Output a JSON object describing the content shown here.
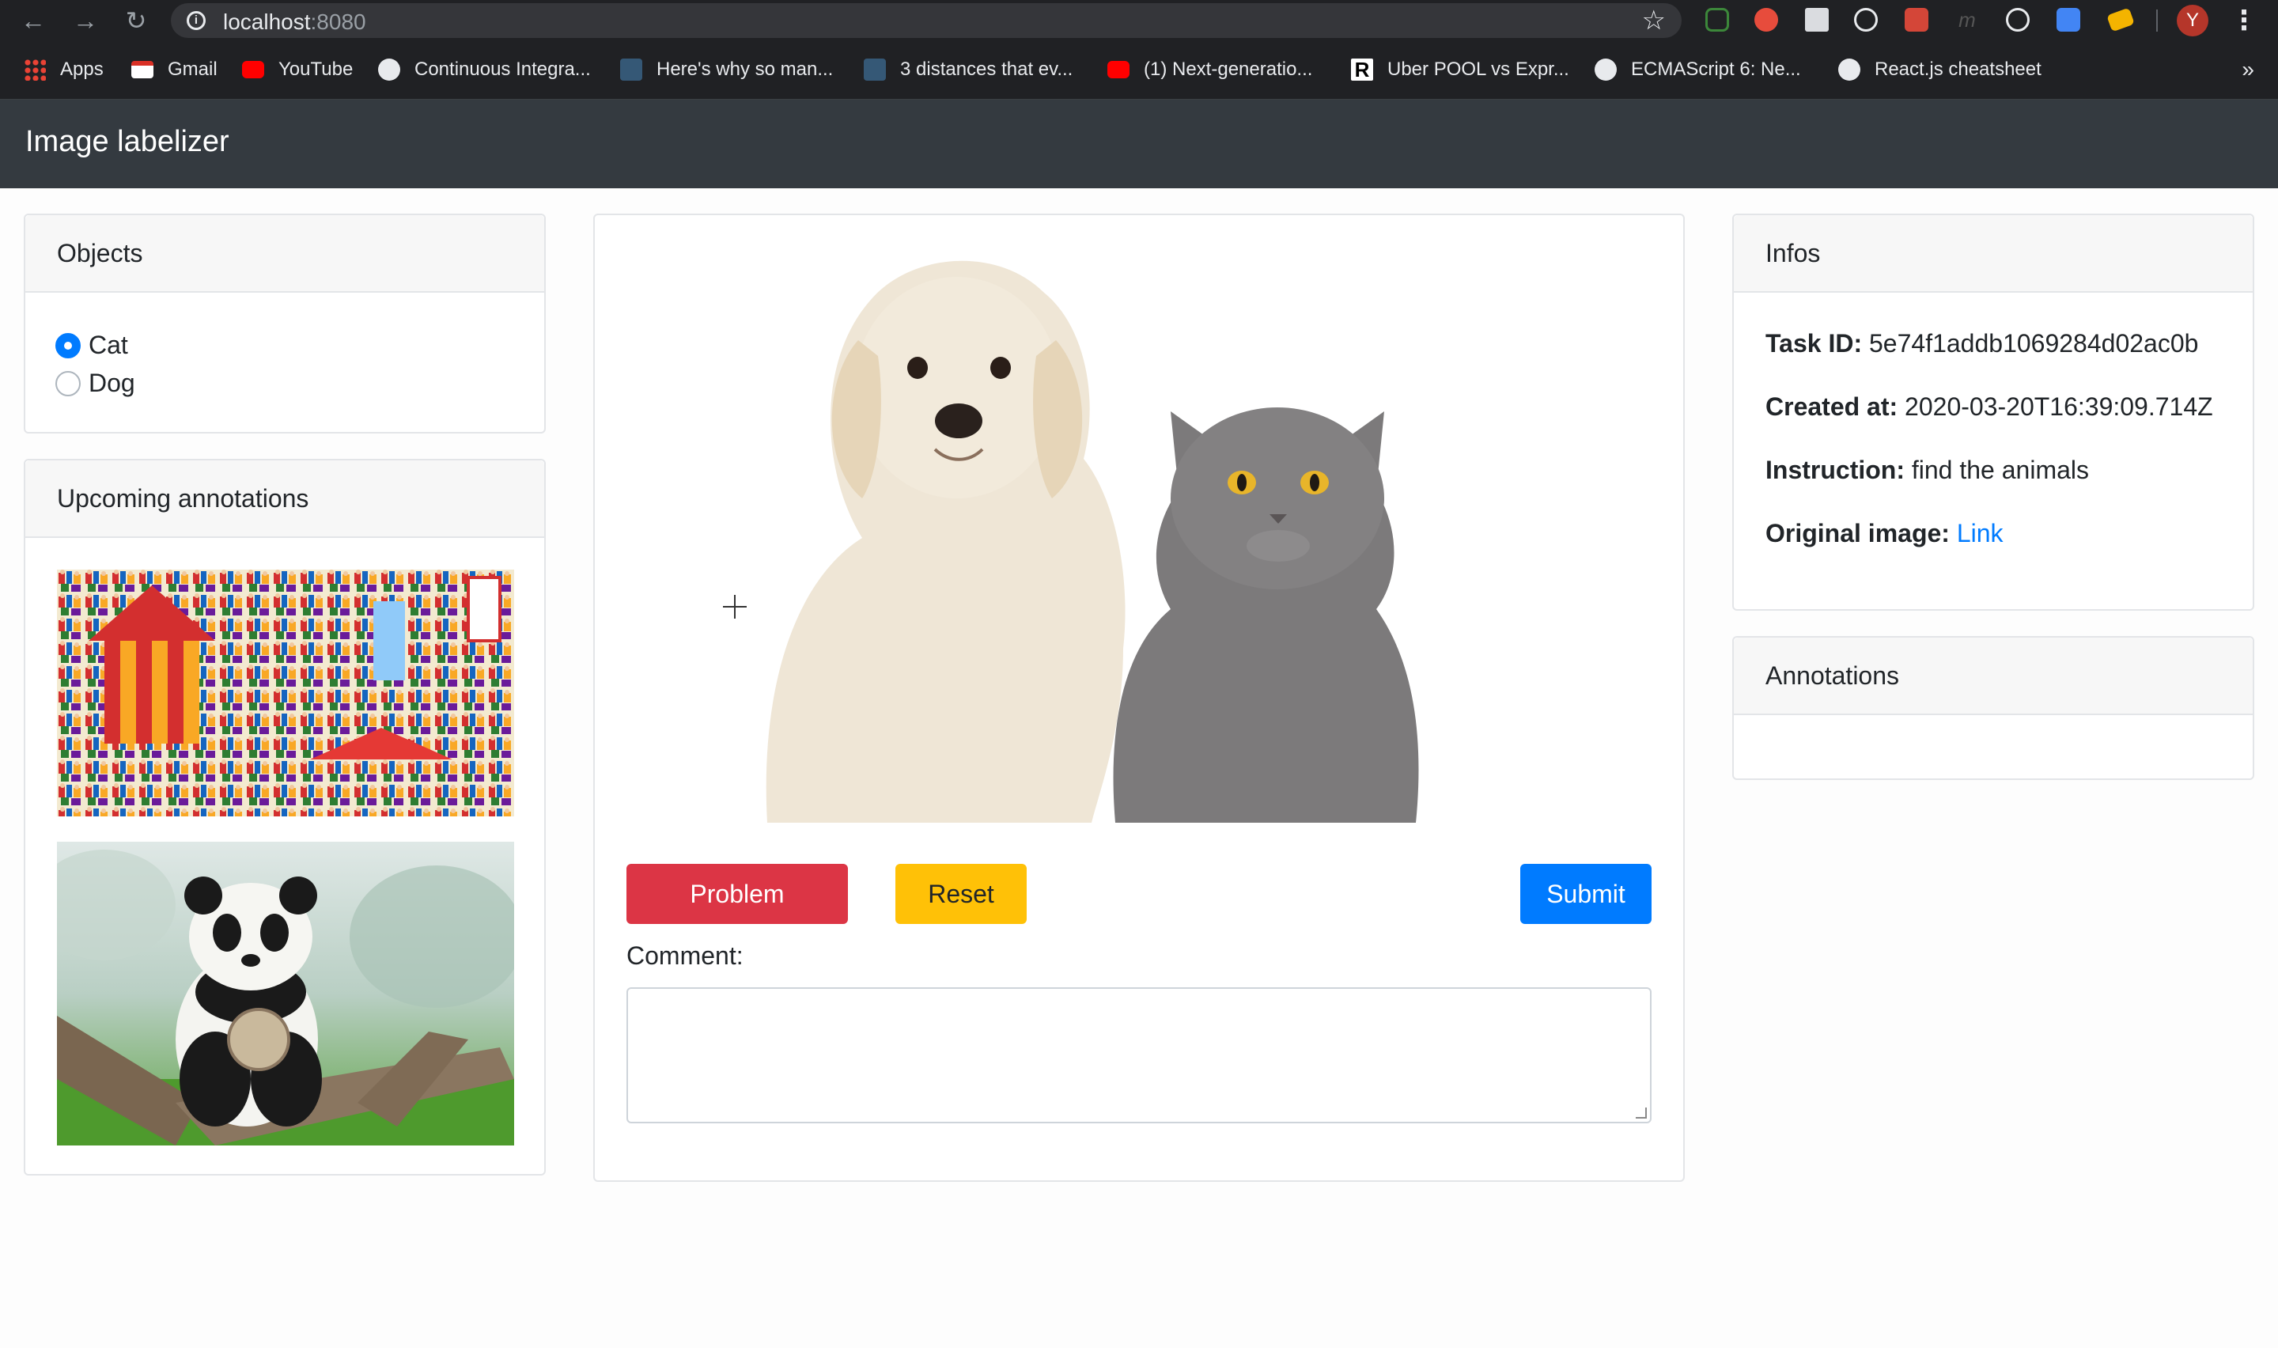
{
  "browser": {
    "url_host": "localhost",
    "url_port": ":8080",
    "bookmarks": [
      {
        "label": "Apps",
        "icon": "apps-grid-icon",
        "color": "#ea4335"
      },
      {
        "label": "Gmail",
        "icon": "gmail-icon",
        "color": "#d93025"
      },
      {
        "label": "YouTube",
        "icon": "youtube-icon",
        "color": "#ff0000"
      },
      {
        "label": "Continuous Integra...",
        "icon": "puzzle-icon",
        "color": "#e8eaed"
      },
      {
        "label": "Here's why so man...",
        "icon": "tds-icon",
        "color": "#355876"
      },
      {
        "label": "3 distances that ev...",
        "icon": "tds-icon",
        "color": "#355876"
      },
      {
        "label": "(1) Next-generatio...",
        "icon": "youtube-icon",
        "color": "#ff0000"
      },
      {
        "label": "Uber POOL vs Expr...",
        "icon": "r-icon",
        "color": "#ffffff"
      },
      {
        "label": "ECMAScript 6: Ne...",
        "icon": "globe-icon",
        "color": "#e8eaed"
      },
      {
        "label": "React.js cheatsheet",
        "icon": "globe-icon",
        "color": "#e8eaed"
      }
    ],
    "more": "»",
    "avatar_initial": "Y"
  },
  "app": {
    "title": "Image labelizer"
  },
  "objects": {
    "header": "Objects",
    "options": [
      {
        "label": "Cat",
        "checked": true
      },
      {
        "label": "Dog",
        "checked": false
      }
    ]
  },
  "upcoming": {
    "header": "Upcoming annotations"
  },
  "actions": {
    "problem": "Problem",
    "reset": "Reset",
    "submit": "Submit",
    "comment_label": "Comment:"
  },
  "infos": {
    "header": "Infos",
    "task_id_label": "Task ID:",
    "task_id": "5e74f1addb1069284d02ac0b",
    "created_label": "Created at:",
    "created": "2020-03-20T16:39:09.714Z",
    "instruction_label": "Instruction:",
    "instruction": "find the animals",
    "original_label": "Original image:",
    "original_link": "Link"
  },
  "annotations": {
    "header": "Annotations"
  },
  "colors": {
    "navbar": "#343a40",
    "primary": "#007bff",
    "danger": "#dc3545",
    "warning": "#ffc107"
  }
}
